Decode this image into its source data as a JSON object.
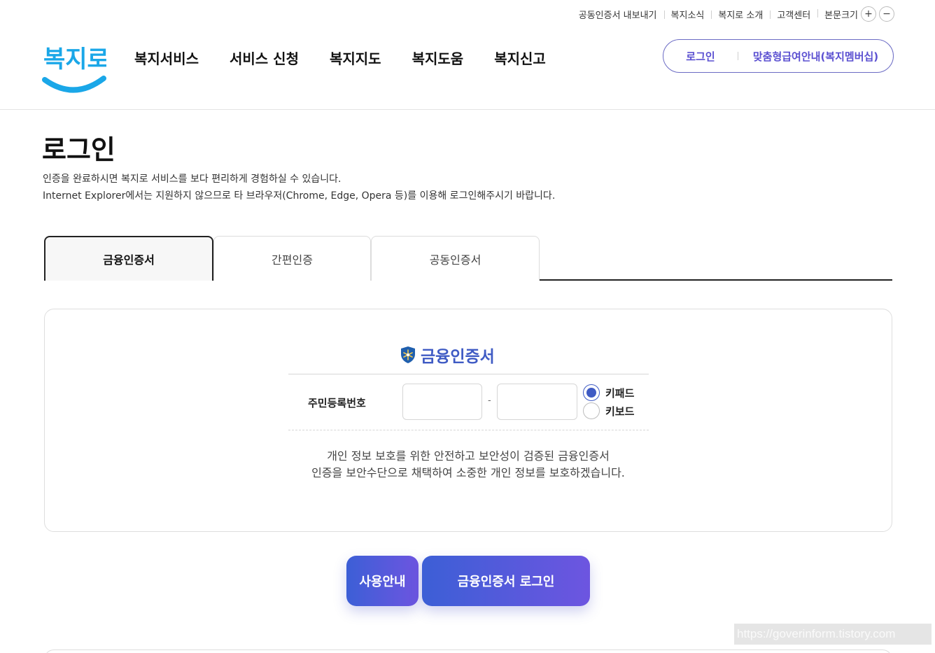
{
  "utility": {
    "items": [
      "공동인증서 내보내기",
      "복지소식",
      "복지로 소개",
      "고객센터"
    ],
    "font_size_label": "본문크기",
    "plus": "+",
    "minus": "−"
  },
  "header": {
    "logo_text": "복지로",
    "nav": [
      "복지서비스",
      "서비스 신청",
      "복지지도",
      "복지도움",
      "복지신고"
    ],
    "login_label": "로그인",
    "membership_label": "맞춤형급여안내(복지멤버십)"
  },
  "page": {
    "title": "로그인",
    "desc_line1": "인증을 완료하시면 복지로 서비스를 보다 편리하게 경험하실 수 있습니다.",
    "desc_line2": "Internet Explorer에서는 지원하지 않으므로 타 브라우저(Chrome, Edge, Opera 등)를 이용해 로그인해주시기 바랍니다."
  },
  "tabs": [
    {
      "label": "금융인증서",
      "active": true
    },
    {
      "label": "간편인증",
      "active": false
    },
    {
      "label": "공동인증서",
      "active": false
    }
  ],
  "panel": {
    "title": "금융인증서",
    "field_label": "주민등록번호",
    "rrn_first_value": "",
    "rrn_second_value": "",
    "dash": "-",
    "radio_keypad": "키패드",
    "radio_keyboard": "키보드",
    "selected_input": "키패드",
    "note_line1": "개인 정보 보호를 위한 안전하고 보안성이 검증된 금융인증서",
    "note_line2": "인증을 보안수단으로 채택하여 소중한 개인 정보를 보호하겠습니다."
  },
  "buttons": {
    "guide": "사용안내",
    "login": "금융인증서 로그인"
  },
  "watermark": "https://goverinform.tistory.com",
  "colors": {
    "accent": "#3f5bc4",
    "brand_purple": "#5a4fd1",
    "logo_blue": "#1aa7e8",
    "gradient_start": "#3c5fd6",
    "gradient_end": "#6d55e0"
  }
}
